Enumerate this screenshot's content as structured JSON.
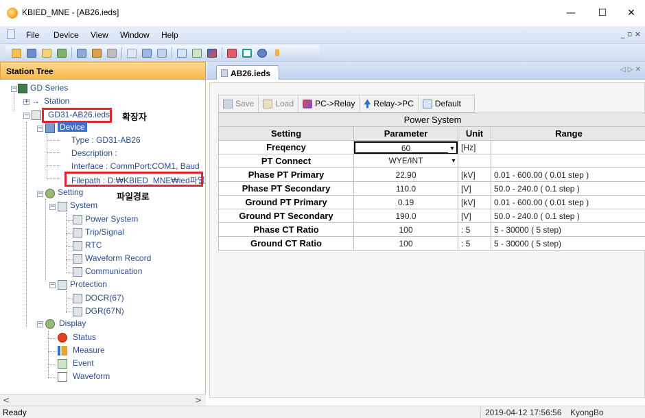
{
  "window": {
    "title": "KBIED_MNE - [AB26.ieds]",
    "minimize": "—",
    "maximize": "☐",
    "close": "✕"
  },
  "menu": {
    "file": "File",
    "device": "Device",
    "view": "View",
    "window": "Window",
    "help": "Help",
    "mdi_controls": "_ ▫ ×"
  },
  "toolbar_icons": [
    "open-icon",
    "save-icon",
    "load-icon",
    "send-icon",
    "tree-icon",
    "back-icon",
    "refresh-icon",
    "add-icon",
    "window-icon",
    "grid-icon",
    "screen-icon",
    "chart-icon",
    "gradient-icon",
    "export-icon",
    "delete-icon",
    "help-icon"
  ],
  "station_tree": {
    "header": "Station Tree",
    "nodes": {
      "gd_series": "GD Series",
      "station": "Station",
      "file": "GD31-AB26.ieds",
      "device": "Device",
      "type": "Type : GD31-AB26",
      "description": "Description :",
      "interface": "Interface : CommPort:COM1, Baud",
      "filepath": "Filepath : D:₩KBIED_MNE₩ied파일",
      "setting": "Setting",
      "system": "System",
      "power_system": "Power System",
      "trip_signal": "Trip/Signal",
      "rtc": "RTC",
      "waveform_record": "Waveform Record",
      "communication": "Communication",
      "protection": "Protection",
      "docr": "DOCR(67)",
      "dgr": "DGR(67N)",
      "display": "Display",
      "status": "Status",
      "measure": "Measure",
      "event": "Event",
      "waveform": "Waveform"
    },
    "annotations": {
      "extension": "확장자",
      "filepath": "파일경로"
    },
    "scroll_left": "<",
    "scroll_right": ">"
  },
  "tabs": {
    "active": "AB26.ieds",
    "nav": "◁ ▷ ✕"
  },
  "actions": {
    "save": "Save",
    "load": "Load",
    "pc_to_relay": "PC->Relay",
    "relay_to_pc": "Relay->PC",
    "default": "Default"
  },
  "power_system": {
    "title": "Power System",
    "headers": {
      "setting": "Setting",
      "parameter": "Parameter",
      "unit": "Unit",
      "range": "Range"
    },
    "rows": [
      {
        "setting": "Freqency",
        "parameter": "60",
        "unit": "[Hz]",
        "range": ""
      },
      {
        "setting": "PT Connect",
        "parameter": "WYE/INT",
        "unit": "",
        "range": ""
      },
      {
        "setting": "Phase PT Primary",
        "parameter": "22.90",
        "unit": "[kV]",
        "range": "0.01 - 600.00 ( 0.01 step )"
      },
      {
        "setting": "Phase PT Secondary",
        "parameter": "110.0",
        "unit": "[V]",
        "range": "50.0 - 240.0 ( 0.1 step )"
      },
      {
        "setting": "Ground PT Primary",
        "parameter": "0.19",
        "unit": "[kV]",
        "range": "0.01 - 600.00 ( 0.01 step )"
      },
      {
        "setting": "Ground PT Secondary",
        "parameter": "190.0",
        "unit": "[V]",
        "range": "50.0 - 240.0 ( 0.1 step )"
      },
      {
        "setting": "Phase CT Ratio",
        "parameter": "100",
        "unit": ": 5",
        "range": "5 - 30000 ( 5 step)"
      },
      {
        "setting": "Ground CT Ratio",
        "parameter": "100",
        "unit": ": 5",
        "range": "5 - 30000 ( 5 step)"
      }
    ]
  },
  "status_bar": {
    "ready": "Ready",
    "datetime": "2019-04-12 17:56:56",
    "user": "KyongBo"
  }
}
